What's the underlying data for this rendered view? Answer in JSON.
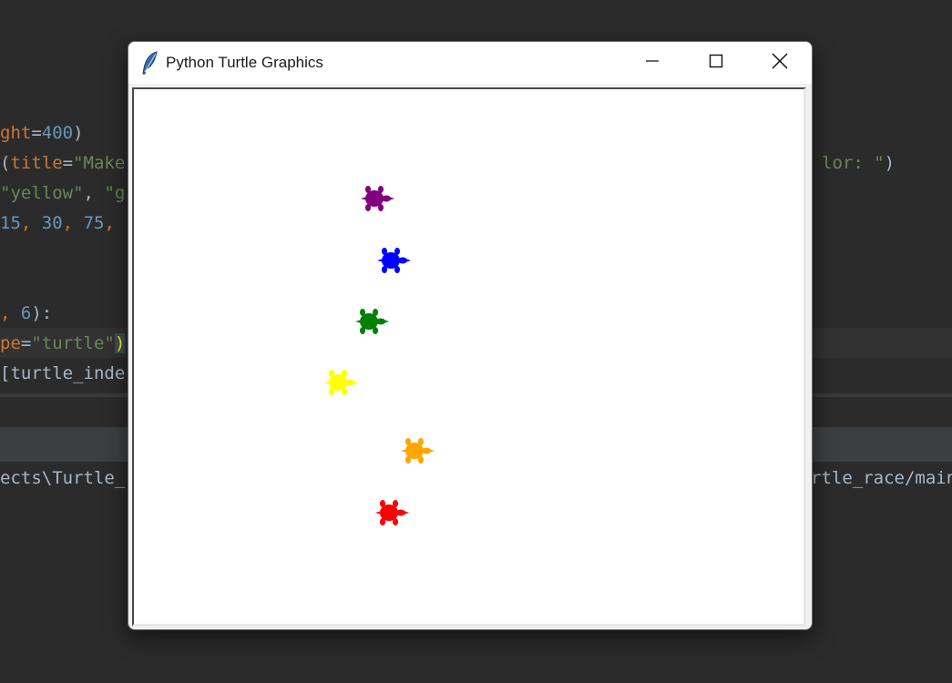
{
  "editor": {
    "lines": [
      [
        {
          "t": "ght",
          "c": "tok-param"
        },
        {
          "t": "=",
          "c": "tok-op"
        },
        {
          "t": "400",
          "c": "tok-num"
        },
        {
          "t": ")",
          "c": "tok-op"
        }
      ],
      [
        {
          "t": "(",
          "c": "tok-op"
        },
        {
          "t": "title",
          "c": "tok-param"
        },
        {
          "t": "=",
          "c": "tok-op"
        },
        {
          "t": "\"Make",
          "c": "tok-str"
        }
      ],
      [
        {
          "t": "\"yellow\"",
          "c": "tok-str"
        },
        {
          "t": ", ",
          "c": "tok-op"
        },
        {
          "t": "\"g",
          "c": "tok-str"
        }
      ],
      [
        {
          "t": "15",
          "c": "tok-num"
        },
        {
          "t": ", ",
          "c": "tok-param"
        },
        {
          "t": "30",
          "c": "tok-num"
        },
        {
          "t": ", ",
          "c": "tok-param"
        },
        {
          "t": "75",
          "c": "tok-num"
        },
        {
          "t": ",",
          "c": "tok-param"
        }
      ],
      [],
      [],
      [
        {
          "t": ", ",
          "c": "tok-param"
        },
        {
          "t": "6",
          "c": "tok-num"
        },
        {
          "t": "):",
          "c": "tok-op"
        }
      ],
      [
        {
          "t": "pe",
          "c": "tok-param"
        },
        {
          "t": "=",
          "c": "tok-op"
        },
        {
          "t": "\"turtle\"",
          "c": "tok-str"
        },
        {
          "t": ")",
          "c": "tok-paren-hl"
        }
      ],
      [
        {
          "t": "[turtle_inde",
          "c": "tok-op"
        }
      ],
      [],
      [],
      [
        {
          "t": "ects\\Turtle_r",
          "c": "tok-op"
        }
      ]
    ],
    "right_fragments": [
      {
        "text": "lor: \")",
        "parts": [
          {
            "t": "lor: ",
            "c": "tok-str"
          },
          {
            "t": "\"",
            "c": "tok-str"
          },
          {
            "t": ")",
            "c": "tok-op"
          }
        ]
      },
      {
        "text": "rtle_race/main",
        "parts": [
          {
            "t": "rtle_race/main",
            "c": "tok-op"
          }
        ]
      }
    ]
  },
  "window": {
    "title": "Python Turtle Graphics",
    "app_icon": "feather-icon",
    "buttons": {
      "minimize": "minimize-icon",
      "maximize": "maximize-icon",
      "close": "close-icon"
    }
  },
  "turtles": [
    {
      "color": "#800080",
      "name": "purple"
    },
    {
      "color": "#0000ff",
      "name": "blue"
    },
    {
      "color": "#008000",
      "name": "green"
    },
    {
      "color": "#ffff00",
      "name": "yellow"
    },
    {
      "color": "#ffa500",
      "name": "orange"
    },
    {
      "color": "#ff0000",
      "name": "red"
    }
  ]
}
